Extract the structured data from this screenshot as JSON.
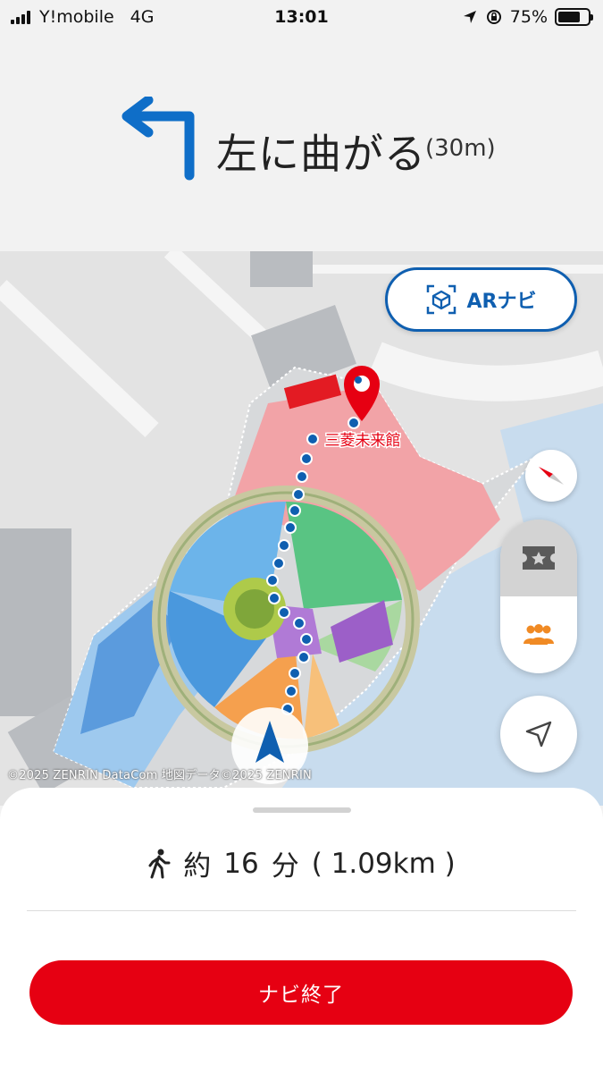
{
  "status_bar": {
    "carrier": "Y!mobile",
    "network": "4G",
    "time": "13:01",
    "battery_percent": "75%",
    "battery_level": 0.75
  },
  "direction": {
    "instruction": "左に曲がる",
    "distance": "(30m)",
    "icon": "turn-left-arrow-icon",
    "color": "#0f6ec8"
  },
  "map": {
    "destination_label": "三菱未来館",
    "copyright": "©2025 ZENRIN DataCom 地図データ©2025 ZENRIN",
    "ar_button_label": "ARナビ",
    "route_color": "#0f5fb0",
    "pin_color": "#e60012"
  },
  "route_summary": {
    "time_prefix": "約",
    "minutes": "16",
    "minutes_unit": "分",
    "distance": "( 1.09km )"
  },
  "actions": {
    "end_navigation_label": "ナビ終了",
    "end_button_color": "#e60012"
  }
}
